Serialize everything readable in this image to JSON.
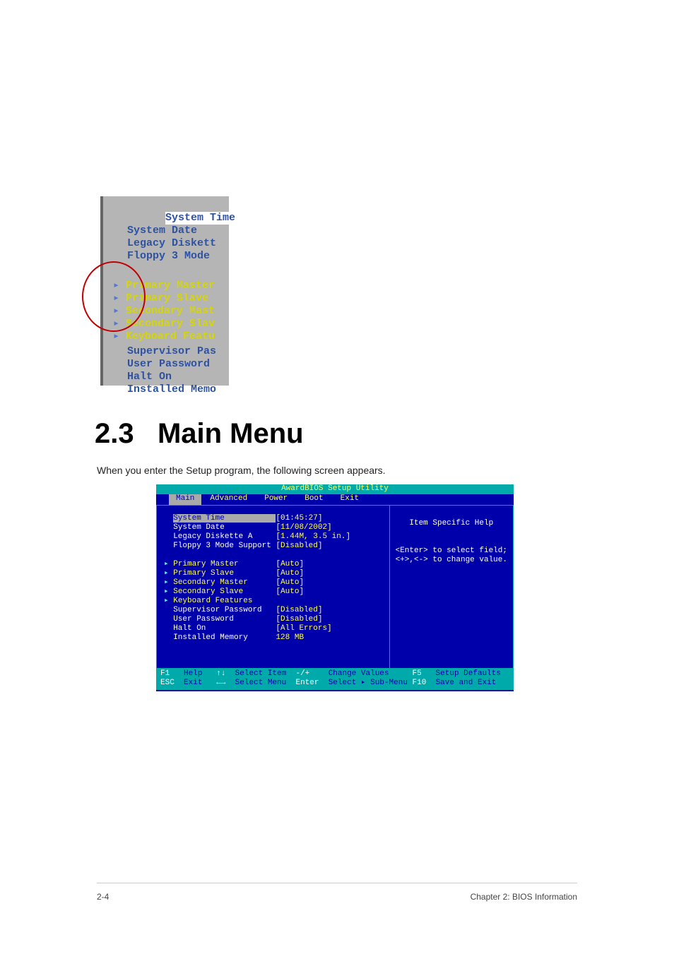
{
  "doc": {
    "page_label": "2-4",
    "chapter_label": "Chapter 2: BIOS Information",
    "heading_number": "2.3",
    "heading_text": "Main Menu",
    "body_text": "When you enter the Setup program, the following screen appears."
  },
  "snippet": {
    "selected_row": "System Time",
    "rows_top": [
      "System Date",
      "Legacy Diskett",
      "Floppy 3 Mode"
    ],
    "submenu_rows": [
      "Primary Master",
      "Primary Slave",
      "Secondary Mast",
      "Secondary Slav",
      "Keyboard Featu"
    ],
    "rows_bottom": [
      "Supervisor Pas",
      "User Password",
      "Halt On",
      "Installed Memo"
    ]
  },
  "bios": {
    "title": "AwardBIOS Setup Utility",
    "tabs": [
      "Main",
      "Advanced",
      "Power",
      "Boot",
      "Exit"
    ],
    "selected_tab": "Main",
    "items": [
      {
        "label": "System Time",
        "value": "[01:45:27]",
        "selected": true,
        "submenu": false
      },
      {
        "label": "System Date",
        "value": "[11/08/2002]",
        "submenu": false
      },
      {
        "label": "Legacy Diskette A",
        "value": "[1.44M, 3.5 in.]",
        "submenu": false
      },
      {
        "label": "Floppy 3 Mode Support",
        "value": "[Disabled]",
        "submenu": false
      },
      {
        "label": "",
        "value": "",
        "submenu": false
      },
      {
        "label": "Primary Master",
        "value": "[Auto]",
        "submenu": true
      },
      {
        "label": "Primary Slave",
        "value": "[Auto]",
        "submenu": true
      },
      {
        "label": "Secondary Master",
        "value": "[Auto]",
        "submenu": true
      },
      {
        "label": "Secondary Slave",
        "value": "[Auto]",
        "submenu": true
      },
      {
        "label": "Keyboard Features",
        "value": "",
        "submenu": true
      },
      {
        "label": "Supervisor Password",
        "value": "[Disabled]",
        "submenu": false
      },
      {
        "label": "User Password",
        "value": "[Disabled]",
        "submenu": false
      },
      {
        "label": "Halt On",
        "value": "[All Errors]",
        "submenu": false
      },
      {
        "label": "Installed Memory",
        "value": "128 MB",
        "submenu": false
      }
    ],
    "help_title": "Item Specific Help",
    "help_lines": [
      "<Enter> to select field;",
      "<+>,<-> to change value."
    ],
    "footer": {
      "f1": "F1",
      "help": "Help",
      "arrows_v": "↑↓",
      "select_item": "Select Item",
      "pm": "-/+",
      "change_values": "Change Values",
      "f5": "F5",
      "setup_defaults": "Setup Defaults",
      "esc": "ESC",
      "exit": "Exit",
      "arrows_h": "←→",
      "select_menu": "Select Menu",
      "enter": "Enter",
      "select_submenu": "Select ▸ Sub-Menu",
      "f10": "F10",
      "save_exit": "Save and Exit"
    }
  }
}
